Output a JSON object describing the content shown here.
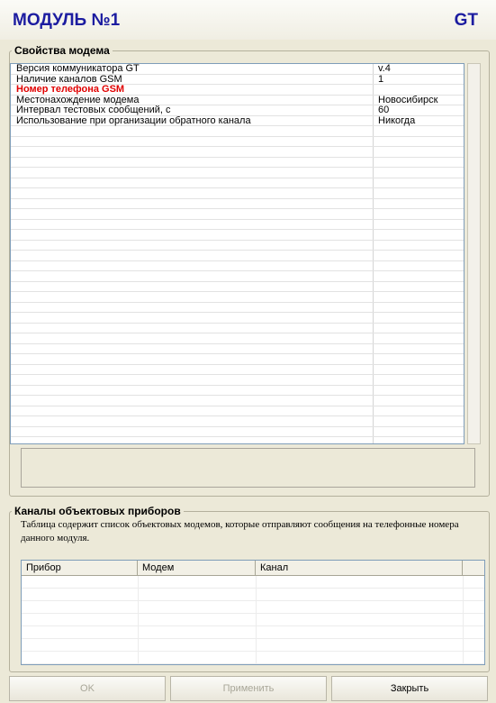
{
  "header": {
    "title": "МОДУЛЬ №1",
    "type": "GT"
  },
  "properties": {
    "legend": "Свойства модема",
    "rows": [
      {
        "name": "Версия коммуникатора GT",
        "value": "v.4",
        "highlight": false
      },
      {
        "name": "Наличие каналов GSM",
        "value": "1",
        "highlight": false
      },
      {
        "name": "Номер телефона GSM",
        "value": "",
        "highlight": true
      },
      {
        "name": "Местонахождение модема",
        "value": "Новосибирск",
        "highlight": false
      },
      {
        "name": "Интервал тестовых сообщений, с",
        "value": "60",
        "highlight": false
      },
      {
        "name": "Использование при организации обратного канала",
        "value": "Никогда",
        "highlight": false
      }
    ],
    "highlight_color": "#e00000"
  },
  "channels": {
    "legend": "Каналы объектовых приборов",
    "description": "Таблица содержит список объектовых модемов, которые отправляют сообщения на телефонные номера данного модуля.",
    "columns": [
      "Прибор",
      "Модем",
      "Канал"
    ],
    "rows": []
  },
  "buttons": {
    "ok": {
      "label": "OK",
      "enabled": false
    },
    "apply": {
      "label": "Применить",
      "enabled": false
    },
    "close": {
      "label": "Закрыть",
      "enabled": true
    }
  },
  "colors": {
    "title": "#1c1ca0",
    "background": "#ece9d8"
  }
}
